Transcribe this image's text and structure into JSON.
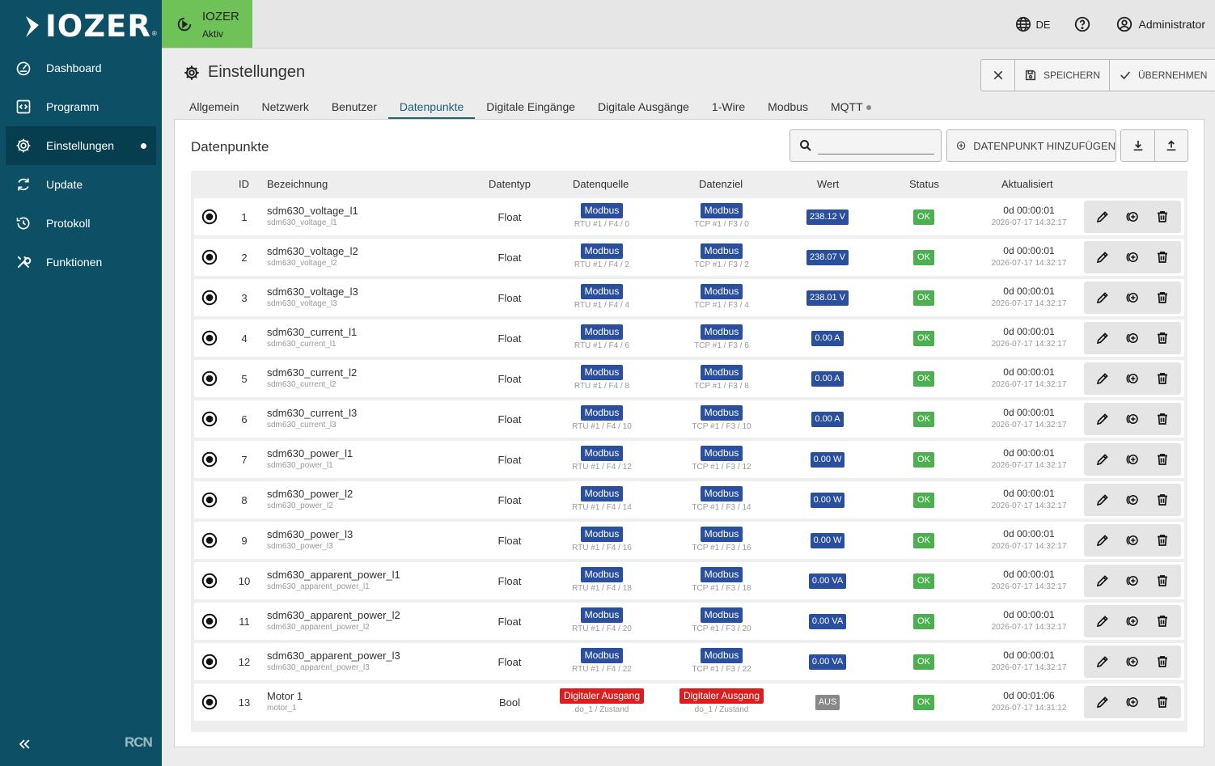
{
  "brand": {
    "logo_text": "IOZER",
    "logo_mark": "®",
    "footer_logo": "RCN"
  },
  "colors": {
    "sidebar": "#0d5065",
    "sidebar_active": "#073e4f",
    "status_green": "#6fc257",
    "accent": "#1b5f78",
    "modbus_blue": "#2a4f9c",
    "digital_red": "#d91f1f",
    "ok_green": "#4caf50"
  },
  "sidebar": {
    "items": [
      {
        "label": "Dashboard",
        "icon": "gauge-icon",
        "active": false
      },
      {
        "label": "Programm",
        "icon": "code-icon",
        "active": false
      },
      {
        "label": "Einstellungen",
        "icon": "gear-icon",
        "active": true
      },
      {
        "label": "Update",
        "icon": "refresh-icon",
        "active": false
      },
      {
        "label": "Protokoll",
        "icon": "history-icon",
        "active": false
      },
      {
        "label": "Funktionen",
        "icon": "tools-icon",
        "active": false
      }
    ]
  },
  "topbar": {
    "status_name": "IOZER",
    "status_sub": "Aktiv",
    "language": "DE",
    "user": "Administrator"
  },
  "header": {
    "title": "Einstellungen",
    "save_label": "SPEICHERN",
    "apply_label": "ÜBERNEHMEN"
  },
  "tabs": [
    {
      "label": "Allgemein",
      "active": false
    },
    {
      "label": "Netzwerk",
      "active": false
    },
    {
      "label": "Benutzer",
      "active": false
    },
    {
      "label": "Datenpunkte",
      "active": true
    },
    {
      "label": "Digitale Eingänge",
      "active": false
    },
    {
      "label": "Digitale Ausgänge",
      "active": false
    },
    {
      "label": "1-Wire",
      "active": false
    },
    {
      "label": "Modbus",
      "active": false
    },
    {
      "label": "MQTT",
      "active": false,
      "dot": true
    }
  ],
  "panel": {
    "title": "Datenpunkte",
    "search_placeholder": "",
    "add_label": "DATENPUNKT HINZUFÜGEN"
  },
  "table": {
    "columns": {
      "id": "ID",
      "name": "Bezeichnung",
      "type": "Datentyp",
      "source": "Datenquelle",
      "target": "Datenziel",
      "value": "Wert",
      "status": "Status",
      "updated": "Aktualisiert"
    },
    "rows": [
      {
        "id": "1",
        "name": "sdm630_voltage_l1",
        "key": "sdm630_voltage_l1",
        "type": "Float",
        "src": "Modbus",
        "src_sub": "RTU #1 / F4 / 0",
        "dst": "Modbus",
        "dst_sub": "TCP #1 / F3 / 0",
        "value": "238.12 V",
        "status": "OK",
        "age": "0d 00:00:01",
        "ts": "2026-07-17 14:32:17"
      },
      {
        "id": "2",
        "name": "sdm630_voltage_l2",
        "key": "sdm630_voltage_l2",
        "type": "Float",
        "src": "Modbus",
        "src_sub": "RTU #1 / F4 / 2",
        "dst": "Modbus",
        "dst_sub": "TCP #1 / F3 / 2",
        "value": "238.07 V",
        "status": "OK",
        "age": "0d 00:00:01",
        "ts": "2026-07-17 14:32:17"
      },
      {
        "id": "3",
        "name": "sdm630_voltage_l3",
        "key": "sdm630_voltage_l3",
        "type": "Float",
        "src": "Modbus",
        "src_sub": "RTU #1 / F4 / 4",
        "dst": "Modbus",
        "dst_sub": "TCP #1 / F3 / 4",
        "value": "238.01 V",
        "status": "OK",
        "age": "0d 00:00:01",
        "ts": "2026-07-17 14:32:17"
      },
      {
        "id": "4",
        "name": "sdm630_current_l1",
        "key": "sdm630_current_l1",
        "type": "Float",
        "src": "Modbus",
        "src_sub": "RTU #1 / F4 / 6",
        "dst": "Modbus",
        "dst_sub": "TCP #1 / F3 / 6",
        "value": "0.00 A",
        "status": "OK",
        "age": "0d 00:00:01",
        "ts": "2026-07-17 14:32:17"
      },
      {
        "id": "5",
        "name": "sdm630_current_l2",
        "key": "sdm630_current_l2",
        "type": "Float",
        "src": "Modbus",
        "src_sub": "RTU #1 / F4 / 8",
        "dst": "Modbus",
        "dst_sub": "TCP #1 / F3 / 8",
        "value": "0.00 A",
        "status": "OK",
        "age": "0d 00:00:01",
        "ts": "2026-07-17 14:32:17"
      },
      {
        "id": "6",
        "name": "sdm630_current_l3",
        "key": "sdm630_current_l3",
        "type": "Float",
        "src": "Modbus",
        "src_sub": "RTU #1 / F4 / 10",
        "dst": "Modbus",
        "dst_sub": "TCP #1 / F3 / 10",
        "value": "0.00 A",
        "status": "OK",
        "age": "0d 00:00:01",
        "ts": "2026-07-17 14:32:17"
      },
      {
        "id": "7",
        "name": "sdm630_power_l1",
        "key": "sdm630_power_l1",
        "type": "Float",
        "src": "Modbus",
        "src_sub": "RTU #1 / F4 / 12",
        "dst": "Modbus",
        "dst_sub": "TCP #1 / F3 / 12",
        "value": "0.00 W",
        "status": "OK",
        "age": "0d 00:00:01",
        "ts": "2026-07-17 14:32:17"
      },
      {
        "id": "8",
        "name": "sdm630_power_l2",
        "key": "sdm630_power_l2",
        "type": "Float",
        "src": "Modbus",
        "src_sub": "RTU #1 / F4 / 14",
        "dst": "Modbus",
        "dst_sub": "TCP #1 / F3 / 14",
        "value": "0.00 W",
        "status": "OK",
        "age": "0d 00:00:01",
        "ts": "2026-07-17 14:32:17"
      },
      {
        "id": "9",
        "name": "sdm630_power_l3",
        "key": "sdm630_power_l3",
        "type": "Float",
        "src": "Modbus",
        "src_sub": "RTU #1 / F4 / 16",
        "dst": "Modbus",
        "dst_sub": "TCP #1 / F3 / 16",
        "value": "0.00 W",
        "status": "OK",
        "age": "0d 00:00:01",
        "ts": "2026-07-17 14:32:17"
      },
      {
        "id": "10",
        "name": "sdm630_apparent_power_l1",
        "key": "sdm630_apparent_power_l1",
        "type": "Float",
        "src": "Modbus",
        "src_sub": "RTU #1 / F4 / 18",
        "dst": "Modbus",
        "dst_sub": "TCP #1 / F3 / 18",
        "value": "0.00 VA",
        "status": "OK",
        "age": "0d 00:00:01",
        "ts": "2026-07-17 14:32:17"
      },
      {
        "id": "11",
        "name": "sdm630_apparent_power_l2",
        "key": "sdm630_apparent_power_l2",
        "type": "Float",
        "src": "Modbus",
        "src_sub": "RTU #1 / F4 / 20",
        "dst": "Modbus",
        "dst_sub": "TCP #1 / F3 / 20",
        "value": "0.00 VA",
        "status": "OK",
        "age": "0d 00:00:01",
        "ts": "2026-07-17 14:32:17"
      },
      {
        "id": "12",
        "name": "sdm630_apparent_power_l3",
        "key": "sdm630_apparent_power_l3",
        "type": "Float",
        "src": "Modbus",
        "src_sub": "RTU #1 / F4 / 22",
        "dst": "Modbus",
        "dst_sub": "TCP #1 / F3 / 22",
        "value": "0.00 VA",
        "status": "OK",
        "age": "0d 00:00:01",
        "ts": "2026-07-17 14:32:17"
      },
      {
        "id": "13",
        "name": "Motor 1",
        "key": "motor_1",
        "type": "Bool",
        "src": "Digitaler Ausgang",
        "src_sub": "do_1 / Zustand",
        "dst": "Digitaler Ausgang",
        "dst_sub": "do_1 / Zustand",
        "value": "AUS",
        "status": "OK",
        "age": "0d 00:01:06",
        "ts": "2026-07-17 14:31:12"
      }
    ]
  }
}
